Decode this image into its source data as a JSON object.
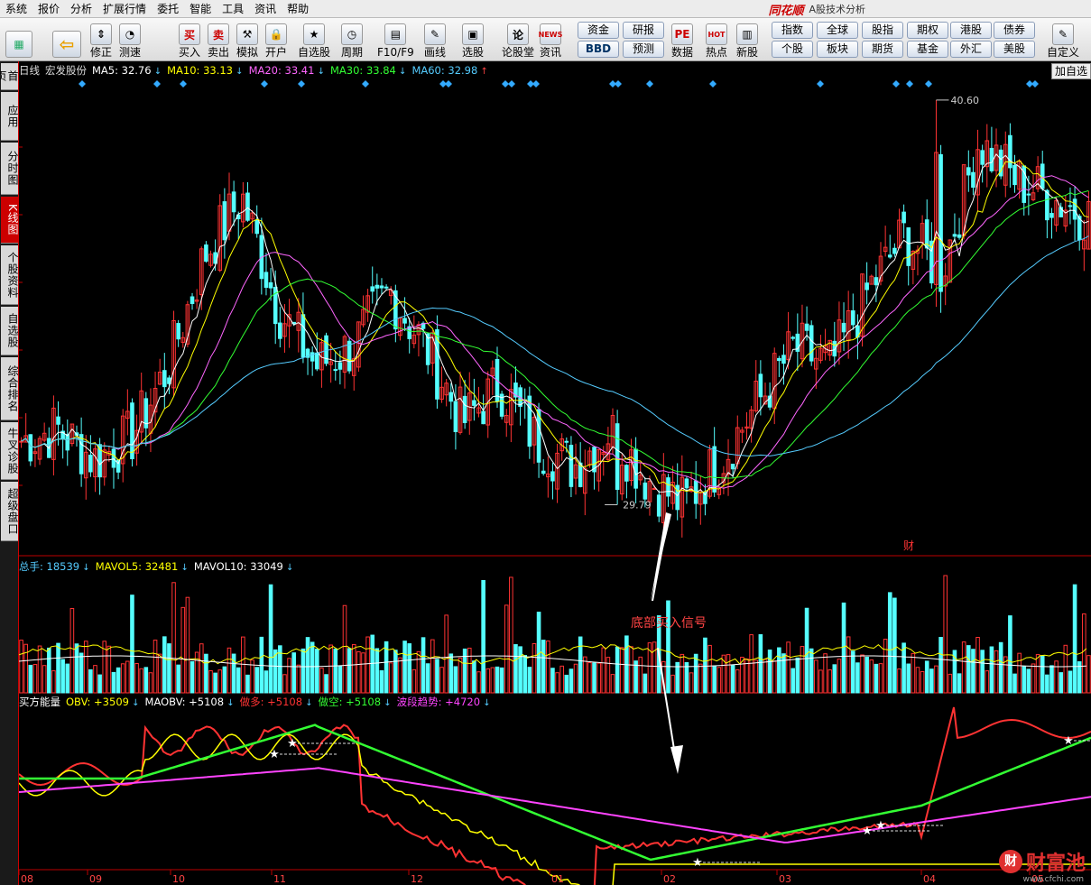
{
  "menu": [
    "系统",
    "报价",
    "分析",
    "扩展行情",
    "委托",
    "智能",
    "工具",
    "资讯",
    "帮助"
  ],
  "brand": {
    "logo": "同花顺",
    "sub": "A股技术分析"
  },
  "toolbar": [
    {
      "label": "",
      "icon": "grid-icon"
    },
    {
      "label": "",
      "icon": "back-arrow-icon"
    },
    {
      "label": "修正",
      "icon": "up-down-arrows-icon"
    },
    {
      "label": "测速",
      "icon": "speed-icon"
    },
    {
      "label": "买入",
      "icon": "buy-icon",
      "glyph": "买"
    },
    {
      "label": "卖出",
      "icon": "sell-icon",
      "glyph": "卖"
    },
    {
      "label": "模拟",
      "icon": "hammer-icon"
    },
    {
      "label": "开户",
      "icon": "lock-icon"
    },
    {
      "label": "自选股",
      "icon": "star-icon"
    },
    {
      "label": "周期",
      "icon": "clock-icon"
    },
    {
      "label": "F10/F9",
      "icon": "doc-icon"
    },
    {
      "label": "画线",
      "icon": "pen-icon"
    },
    {
      "label": "选股",
      "icon": "screen-icon"
    },
    {
      "label": "论股堂",
      "icon": "lun-icon"
    },
    {
      "label": "资讯",
      "icon": "news-icon",
      "glyph": "NEWS"
    },
    {
      "label": "数据",
      "icon": "pe-icon",
      "glyph": "PE"
    },
    {
      "label": "热点",
      "icon": "hot-icon",
      "glyph": "HOT"
    },
    {
      "label": "新股",
      "icon": "new-stock-icon"
    },
    {
      "label": "自定义",
      "icon": "custom-icon"
    }
  ],
  "small_buttons": [
    "资金",
    "研报",
    "BBD",
    "预测",
    "指数",
    "全球",
    "股指",
    "期权",
    "港股",
    "债券",
    "个股",
    "板块",
    "期货",
    "基金",
    "外汇",
    "美股"
  ],
  "sidebar_tabs": [
    "首页",
    "应用",
    "分时图",
    "K线图",
    "个股资料",
    "自选股",
    "综合排名",
    "牛叉诊股",
    "超级盘口"
  ],
  "sidebar_active": "K线图",
  "add_button": "加自选",
  "price_legend": {
    "period": "日线",
    "name": "宏发股份",
    "items": [
      {
        "label": "MA5: 32.76",
        "color": "#ffffff",
        "dir": "down"
      },
      {
        "label": "MA10: 33.13",
        "color": "#ffff00",
        "dir": "down"
      },
      {
        "label": "MA20: 33.41",
        "color": "#ff66ff",
        "dir": "down"
      },
      {
        "label": "MA30: 33.84",
        "color": "#33ff33",
        "dir": "down"
      },
      {
        "label": "MA60: 32.98",
        "color": "#55ccff",
        "dir": "up"
      }
    ]
  },
  "vol_legend": [
    {
      "label": "总手: 18539",
      "color": "#55ccff",
      "dir": "down"
    },
    {
      "label": "MAVOL5: 32481",
      "color": "#ffff00",
      "dir": "down"
    },
    {
      "label": "MAVOL10: 33049",
      "color": "#ffffff",
      "dir": "down"
    }
  ],
  "obv_legend": [
    {
      "label": "买方能量",
      "color": "#ffffff"
    },
    {
      "label": "OBV: +3509",
      "color": "#ffff00",
      "dir": "down"
    },
    {
      "label": "MAOBV: +5108",
      "color": "#ffffff",
      "dir": "down"
    },
    {
      "label": "做多: +5108",
      "color": "#ff3333",
      "dir": "down"
    },
    {
      "label": "做空: +5108",
      "color": "#33ff33",
      "dir": "down"
    },
    {
      "label": "波段趋势: +4720",
      "color": "#ff44ff",
      "dir": "down"
    }
  ],
  "high_label": "40.60",
  "low_label": "29.79",
  "annotation": "底部买入信号",
  "fin_marker": "财",
  "months": [
    "08",
    "09",
    "10",
    "11",
    "12",
    "01",
    "02",
    "03",
    "04",
    "05"
  ],
  "watermark": {
    "text": "财富池",
    "url": "www.cfchi.com",
    "glyph": "财"
  },
  "chart_data": {
    "type": "candlestick",
    "high": 40.6,
    "low": 29.79,
    "price_anchors": [
      31.5,
      31.8,
      31.0,
      31.6,
      33.5,
      36.5,
      38.0,
      35.0,
      33.5,
      34.0,
      35.5,
      34.0,
      32.0,
      33.0,
      31.5,
      30.8,
      31.8,
      30.5,
      29.8,
      31.0,
      32.5,
      34.0,
      33.5,
      35.5,
      37.0,
      36.0,
      39.5,
      38.5,
      38.0,
      37.5
    ]
  }
}
